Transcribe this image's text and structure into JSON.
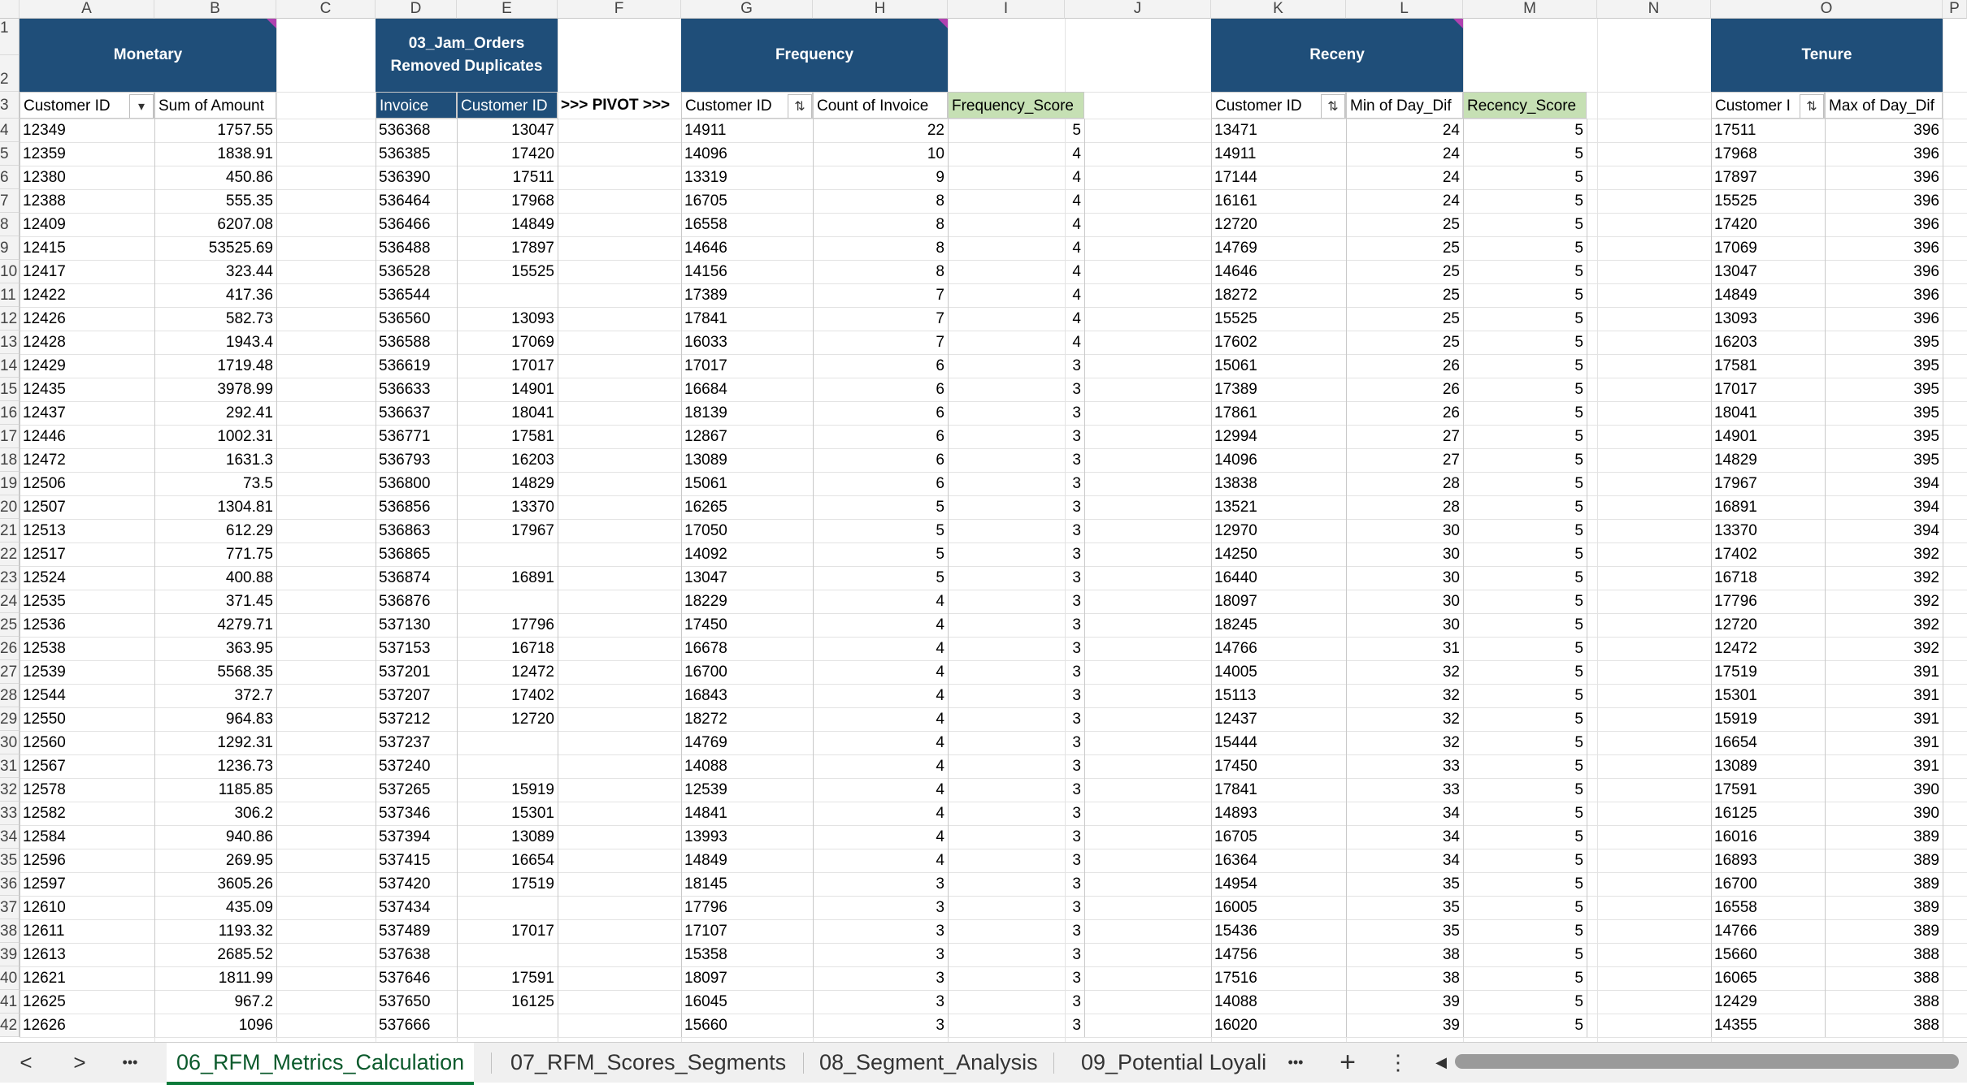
{
  "sheet": {
    "columns": [
      "A",
      "B",
      "C",
      "D",
      "E",
      "F",
      "G",
      "H",
      "I",
      "J",
      "K",
      "L",
      "M",
      "N",
      "O",
      "P"
    ],
    "row_numbers": [
      "1",
      "2",
      "3",
      "4",
      "5",
      "6",
      "7",
      "8",
      "9",
      "10",
      "11",
      "12",
      "13",
      "14",
      "15",
      "16",
      "17",
      "18",
      "19",
      "20",
      "21",
      "22",
      "23",
      "24",
      "25",
      "26",
      "27",
      "28",
      "29",
      "30",
      "31",
      "32",
      "33",
      "34",
      "35",
      "36",
      "37",
      "38",
      "39",
      "40",
      "41",
      "42"
    ]
  },
  "monetary": {
    "title": "Monetary",
    "headers": [
      "Customer ID",
      "Sum of Amount"
    ],
    "rows": [
      [
        "12349",
        "1757.55"
      ],
      [
        "12359",
        "1838.91"
      ],
      [
        "12380",
        "450.86"
      ],
      [
        "12388",
        "555.35"
      ],
      [
        "12409",
        "6207.08"
      ],
      [
        "12415",
        "53525.69"
      ],
      [
        "12417",
        "323.44"
      ],
      [
        "12422",
        "417.36"
      ],
      [
        "12426",
        "582.73"
      ],
      [
        "12428",
        "1943.4"
      ],
      [
        "12429",
        "1719.48"
      ],
      [
        "12435",
        "3978.99"
      ],
      [
        "12437",
        "292.41"
      ],
      [
        "12446",
        "1002.31"
      ],
      [
        "12472",
        "1631.3"
      ],
      [
        "12506",
        "73.5"
      ],
      [
        "12507",
        "1304.81"
      ],
      [
        "12513",
        "612.29"
      ],
      [
        "12517",
        "771.75"
      ],
      [
        "12524",
        "400.88"
      ],
      [
        "12535",
        "371.45"
      ],
      [
        "12536",
        "4279.71"
      ],
      [
        "12538",
        "363.95"
      ],
      [
        "12539",
        "5568.35"
      ],
      [
        "12544",
        "372.7"
      ],
      [
        "12550",
        "964.83"
      ],
      [
        "12560",
        "1292.31"
      ],
      [
        "12567",
        "1236.73"
      ],
      [
        "12578",
        "1185.85"
      ],
      [
        "12582",
        "306.2"
      ],
      [
        "12584",
        "940.86"
      ],
      [
        "12596",
        "269.95"
      ],
      [
        "12597",
        "3605.26"
      ],
      [
        "12610",
        "435.09"
      ],
      [
        "12611",
        "1193.32"
      ],
      [
        "12613",
        "2685.52"
      ],
      [
        "12621",
        "1811.99"
      ],
      [
        "12625",
        "967.2"
      ],
      [
        "12626",
        "1096"
      ]
    ]
  },
  "orders": {
    "title_line1": "03_Jam_Orders",
    "title_line2": "Removed Duplicates",
    "headers": [
      "Invoice",
      "Customer ID"
    ],
    "pivot_label": ">>> PIVOT >>>",
    "rows": [
      [
        "536368",
        "13047"
      ],
      [
        "536385",
        "17420"
      ],
      [
        "536390",
        "17511"
      ],
      [
        "536464",
        "17968"
      ],
      [
        "536466",
        "14849"
      ],
      [
        "536488",
        "17897"
      ],
      [
        "536528",
        "15525"
      ],
      [
        "536544",
        ""
      ],
      [
        "536560",
        "13093"
      ],
      [
        "536588",
        "17069"
      ],
      [
        "536619",
        "17017"
      ],
      [
        "536633",
        "14901"
      ],
      [
        "536637",
        "18041"
      ],
      [
        "536771",
        "17581"
      ],
      [
        "536793",
        "16203"
      ],
      [
        "536800",
        "14829"
      ],
      [
        "536856",
        "13370"
      ],
      [
        "536863",
        "17967"
      ],
      [
        "536865",
        ""
      ],
      [
        "536874",
        "16891"
      ],
      [
        "536876",
        ""
      ],
      [
        "537130",
        "17796"
      ],
      [
        "537153",
        "16718"
      ],
      [
        "537201",
        "12472"
      ],
      [
        "537207",
        "17402"
      ],
      [
        "537212",
        "12720"
      ],
      [
        "537237",
        ""
      ],
      [
        "537240",
        ""
      ],
      [
        "537265",
        "15919"
      ],
      [
        "537346",
        "15301"
      ],
      [
        "537394",
        "13089"
      ],
      [
        "537415",
        "16654"
      ],
      [
        "537420",
        "17519"
      ],
      [
        "537434",
        ""
      ],
      [
        "537489",
        "17017"
      ],
      [
        "537638",
        ""
      ],
      [
        "537646",
        "17591"
      ],
      [
        "537650",
        "16125"
      ],
      [
        "537666",
        ""
      ]
    ]
  },
  "frequency": {
    "title": "Frequency",
    "headers": [
      "Customer ID",
      "Count of Invoice",
      "Frequency_Score"
    ],
    "rows": [
      [
        "14911",
        "22",
        "5"
      ],
      [
        "14096",
        "10",
        "4"
      ],
      [
        "13319",
        "9",
        "4"
      ],
      [
        "16705",
        "8",
        "4"
      ],
      [
        "16558",
        "8",
        "4"
      ],
      [
        "14646",
        "8",
        "4"
      ],
      [
        "14156",
        "8",
        "4"
      ],
      [
        "17389",
        "7",
        "4"
      ],
      [
        "17841",
        "7",
        "4"
      ],
      [
        "16033",
        "7",
        "4"
      ],
      [
        "17017",
        "6",
        "3"
      ],
      [
        "16684",
        "6",
        "3"
      ],
      [
        "18139",
        "6",
        "3"
      ],
      [
        "12867",
        "6",
        "3"
      ],
      [
        "13089",
        "6",
        "3"
      ],
      [
        "15061",
        "6",
        "3"
      ],
      [
        "16265",
        "5",
        "3"
      ],
      [
        "17050",
        "5",
        "3"
      ],
      [
        "14092",
        "5",
        "3"
      ],
      [
        "13047",
        "5",
        "3"
      ],
      [
        "18229",
        "4",
        "3"
      ],
      [
        "17450",
        "4",
        "3"
      ],
      [
        "16678",
        "4",
        "3"
      ],
      [
        "16700",
        "4",
        "3"
      ],
      [
        "16843",
        "4",
        "3"
      ],
      [
        "18272",
        "4",
        "3"
      ],
      [
        "14769",
        "4",
        "3"
      ],
      [
        "14088",
        "4",
        "3"
      ],
      [
        "12539",
        "4",
        "3"
      ],
      [
        "14841",
        "4",
        "3"
      ],
      [
        "13993",
        "4",
        "3"
      ],
      [
        "14849",
        "4",
        "3"
      ],
      [
        "18145",
        "3",
        "3"
      ],
      [
        "17796",
        "3",
        "3"
      ],
      [
        "17107",
        "3",
        "3"
      ],
      [
        "15358",
        "3",
        "3"
      ],
      [
        "18097",
        "3",
        "3"
      ],
      [
        "16045",
        "3",
        "3"
      ],
      [
        "15660",
        "3",
        "3"
      ]
    ]
  },
  "recency": {
    "title": "Receny",
    "headers": [
      "Customer ID",
      "Min of Day_Dif",
      "Recency_Score"
    ],
    "rows": [
      [
        "13471",
        "24",
        "5"
      ],
      [
        "14911",
        "24",
        "5"
      ],
      [
        "17144",
        "24",
        "5"
      ],
      [
        "16161",
        "24",
        "5"
      ],
      [
        "12720",
        "25",
        "5"
      ],
      [
        "14769",
        "25",
        "5"
      ],
      [
        "14646",
        "25",
        "5"
      ],
      [
        "18272",
        "25",
        "5"
      ],
      [
        "15525",
        "25",
        "5"
      ],
      [
        "17602",
        "25",
        "5"
      ],
      [
        "15061",
        "26",
        "5"
      ],
      [
        "17389",
        "26",
        "5"
      ],
      [
        "17861",
        "26",
        "5"
      ],
      [
        "12994",
        "27",
        "5"
      ],
      [
        "14096",
        "27",
        "5"
      ],
      [
        "13838",
        "28",
        "5"
      ],
      [
        "13521",
        "28",
        "5"
      ],
      [
        "12970",
        "30",
        "5"
      ],
      [
        "14250",
        "30",
        "5"
      ],
      [
        "16440",
        "30",
        "5"
      ],
      [
        "18097",
        "30",
        "5"
      ],
      [
        "18245",
        "30",
        "5"
      ],
      [
        "14766",
        "31",
        "5"
      ],
      [
        "14005",
        "32",
        "5"
      ],
      [
        "15113",
        "32",
        "5"
      ],
      [
        "12437",
        "32",
        "5"
      ],
      [
        "15444",
        "32",
        "5"
      ],
      [
        "17450",
        "33",
        "5"
      ],
      [
        "17841",
        "33",
        "5"
      ],
      [
        "14893",
        "34",
        "5"
      ],
      [
        "16705",
        "34",
        "5"
      ],
      [
        "16364",
        "34",
        "5"
      ],
      [
        "14954",
        "35",
        "5"
      ],
      [
        "16005",
        "35",
        "5"
      ],
      [
        "15436",
        "35",
        "5"
      ],
      [
        "14756",
        "38",
        "5"
      ],
      [
        "17516",
        "38",
        "5"
      ],
      [
        "14088",
        "39",
        "5"
      ],
      [
        "16020",
        "39",
        "5"
      ]
    ]
  },
  "tenure": {
    "title": "Tenure",
    "headers": [
      "Customer I",
      "Max of Day_Dif"
    ],
    "rows": [
      [
        "17511",
        "396"
      ],
      [
        "17968",
        "396"
      ],
      [
        "17897",
        "396"
      ],
      [
        "15525",
        "396"
      ],
      [
        "17420",
        "396"
      ],
      [
        "17069",
        "396"
      ],
      [
        "13047",
        "396"
      ],
      [
        "14849",
        "396"
      ],
      [
        "13093",
        "396"
      ],
      [
        "16203",
        "395"
      ],
      [
        "17581",
        "395"
      ],
      [
        "17017",
        "395"
      ],
      [
        "18041",
        "395"
      ],
      [
        "14901",
        "395"
      ],
      [
        "14829",
        "395"
      ],
      [
        "17967",
        "394"
      ],
      [
        "16891",
        "394"
      ],
      [
        "13370",
        "394"
      ],
      [
        "17402",
        "392"
      ],
      [
        "16718",
        "392"
      ],
      [
        "17796",
        "392"
      ],
      [
        "12720",
        "392"
      ],
      [
        "12472",
        "392"
      ],
      [
        "17519",
        "391"
      ],
      [
        "15301",
        "391"
      ],
      [
        "15919",
        "391"
      ],
      [
        "16654",
        "391"
      ],
      [
        "13089",
        "391"
      ],
      [
        "17591",
        "390"
      ],
      [
        "16125",
        "390"
      ],
      [
        "16016",
        "389"
      ],
      [
        "16893",
        "389"
      ],
      [
        "16700",
        "389"
      ],
      [
        "16558",
        "389"
      ],
      [
        "14766",
        "389"
      ],
      [
        "15660",
        "388"
      ],
      [
        "16065",
        "388"
      ],
      [
        "12429",
        "388"
      ],
      [
        "14355",
        "388"
      ]
    ]
  },
  "tabs": {
    "prev": "<",
    "next": ">",
    "more_left": "•••",
    "items": [
      "06_RFM_Metrics_Calculation",
      "07_RFM_Scores_Segments",
      "08_Segment_Analysis",
      "09_Potential Loyali"
    ],
    "more_right": "•••",
    "add": "+",
    "options": "⋮",
    "scroll_left": "◀"
  },
  "colors": {
    "header_blue": "#1f4e79",
    "score_green": "#c6e0b4",
    "active_tab": "#0b7a3a"
  }
}
